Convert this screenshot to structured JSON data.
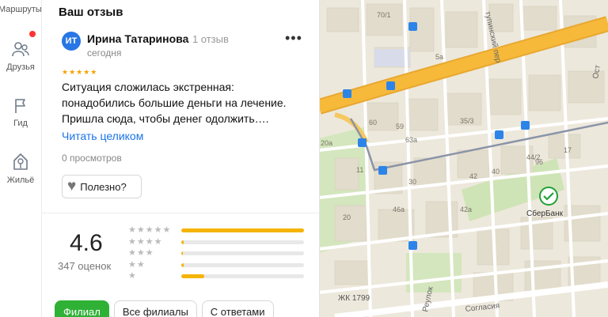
{
  "rail": {
    "top_label": "Маршруты",
    "items": [
      {
        "label": "Друзья",
        "icon": "people-icon"
      },
      {
        "label": "Гид",
        "icon": "flag-icon"
      },
      {
        "label": "Жильё",
        "icon": "house-icon"
      }
    ]
  },
  "review_panel": {
    "title": "Ваш отзыв",
    "review": {
      "avatar_initials": "ИТ",
      "author": "Ирина Татаринова",
      "author_meta": "· 1 отзыв",
      "date": "сегодня",
      "stars": "★★★★★",
      "text": "Ситуация сложилась экстренная: понадобились большие деньги на лечение. Пришла сюда, чтобы денег одолжить….",
      "read_more": "Читать целиком",
      "views": "0 просмотров",
      "useful_button": "Полезно?",
      "more_menu": "•••"
    },
    "rating": {
      "value": "4.6",
      "count_label": "347 оценок",
      "distribution": [
        {
          "stars": "★★★★★",
          "fraction": 1.0
        },
        {
          "stars": "★★★★",
          "fraction": 0.02
        },
        {
          "stars": "★★★",
          "fraction": 0.015
        },
        {
          "stars": "★★",
          "fraction": 0.02
        },
        {
          "stars": "★",
          "fraction": 0.19
        }
      ]
    },
    "filter_chips": [
      "Филиал",
      "Все филиалы",
      "С ответами"
    ]
  },
  "map": {
    "labels": [
      "70/1",
      "5a",
      "60",
      "59",
      "63а",
      "35/3",
      "44/2",
      "40",
      "42",
      "42а",
      "30",
      "20",
      "46а",
      "20а",
      "11",
      "96",
      "17",
      "ЖК 1799",
      "Согласия",
      "Реулок",
      "СберБанк",
      "Ост",
      "тупинский пер"
    ],
    "colors": {
      "main_road": "#f6b93a",
      "tram": "#8a94a8",
      "park": "#cfe4b6",
      "building": "#e2dccc",
      "sber": "#21a038",
      "bus_stop": "#2d84e8"
    }
  }
}
